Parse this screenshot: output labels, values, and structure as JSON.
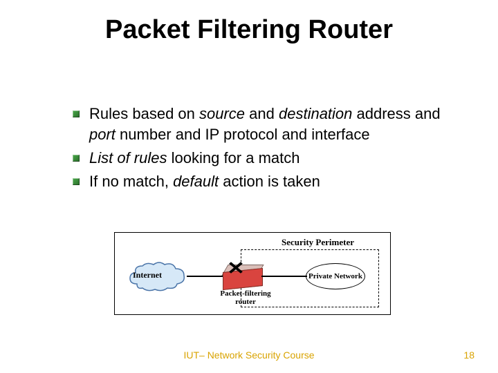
{
  "title": "Packet Filtering Router",
  "bullets": [
    {
      "segments": [
        {
          "t": "Rules based on ",
          "i": false
        },
        {
          "t": "source",
          "i": true
        },
        {
          "t": " and ",
          "i": false
        },
        {
          "t": "destination",
          "i": true
        },
        {
          "t": " address and ",
          "i": false
        },
        {
          "t": "port",
          "i": true
        },
        {
          "t": " number and IP protocol and interface",
          "i": false
        }
      ]
    },
    {
      "segments": [
        {
          "t": "List of rules",
          "i": true
        },
        {
          "t": " looking for a match",
          "i": false
        }
      ]
    },
    {
      "segments": [
        {
          "t": "If no match, ",
          "i": false
        },
        {
          "t": "default",
          "i": true
        },
        {
          "t": " action is taken",
          "i": false
        }
      ]
    }
  ],
  "diagram": {
    "security_perimeter": "Security Perimeter",
    "internet": "Internet",
    "router_label": "Packet-filtering router",
    "private_network": "Private Network"
  },
  "footer": "IUT– Network Security Course",
  "page": "18"
}
